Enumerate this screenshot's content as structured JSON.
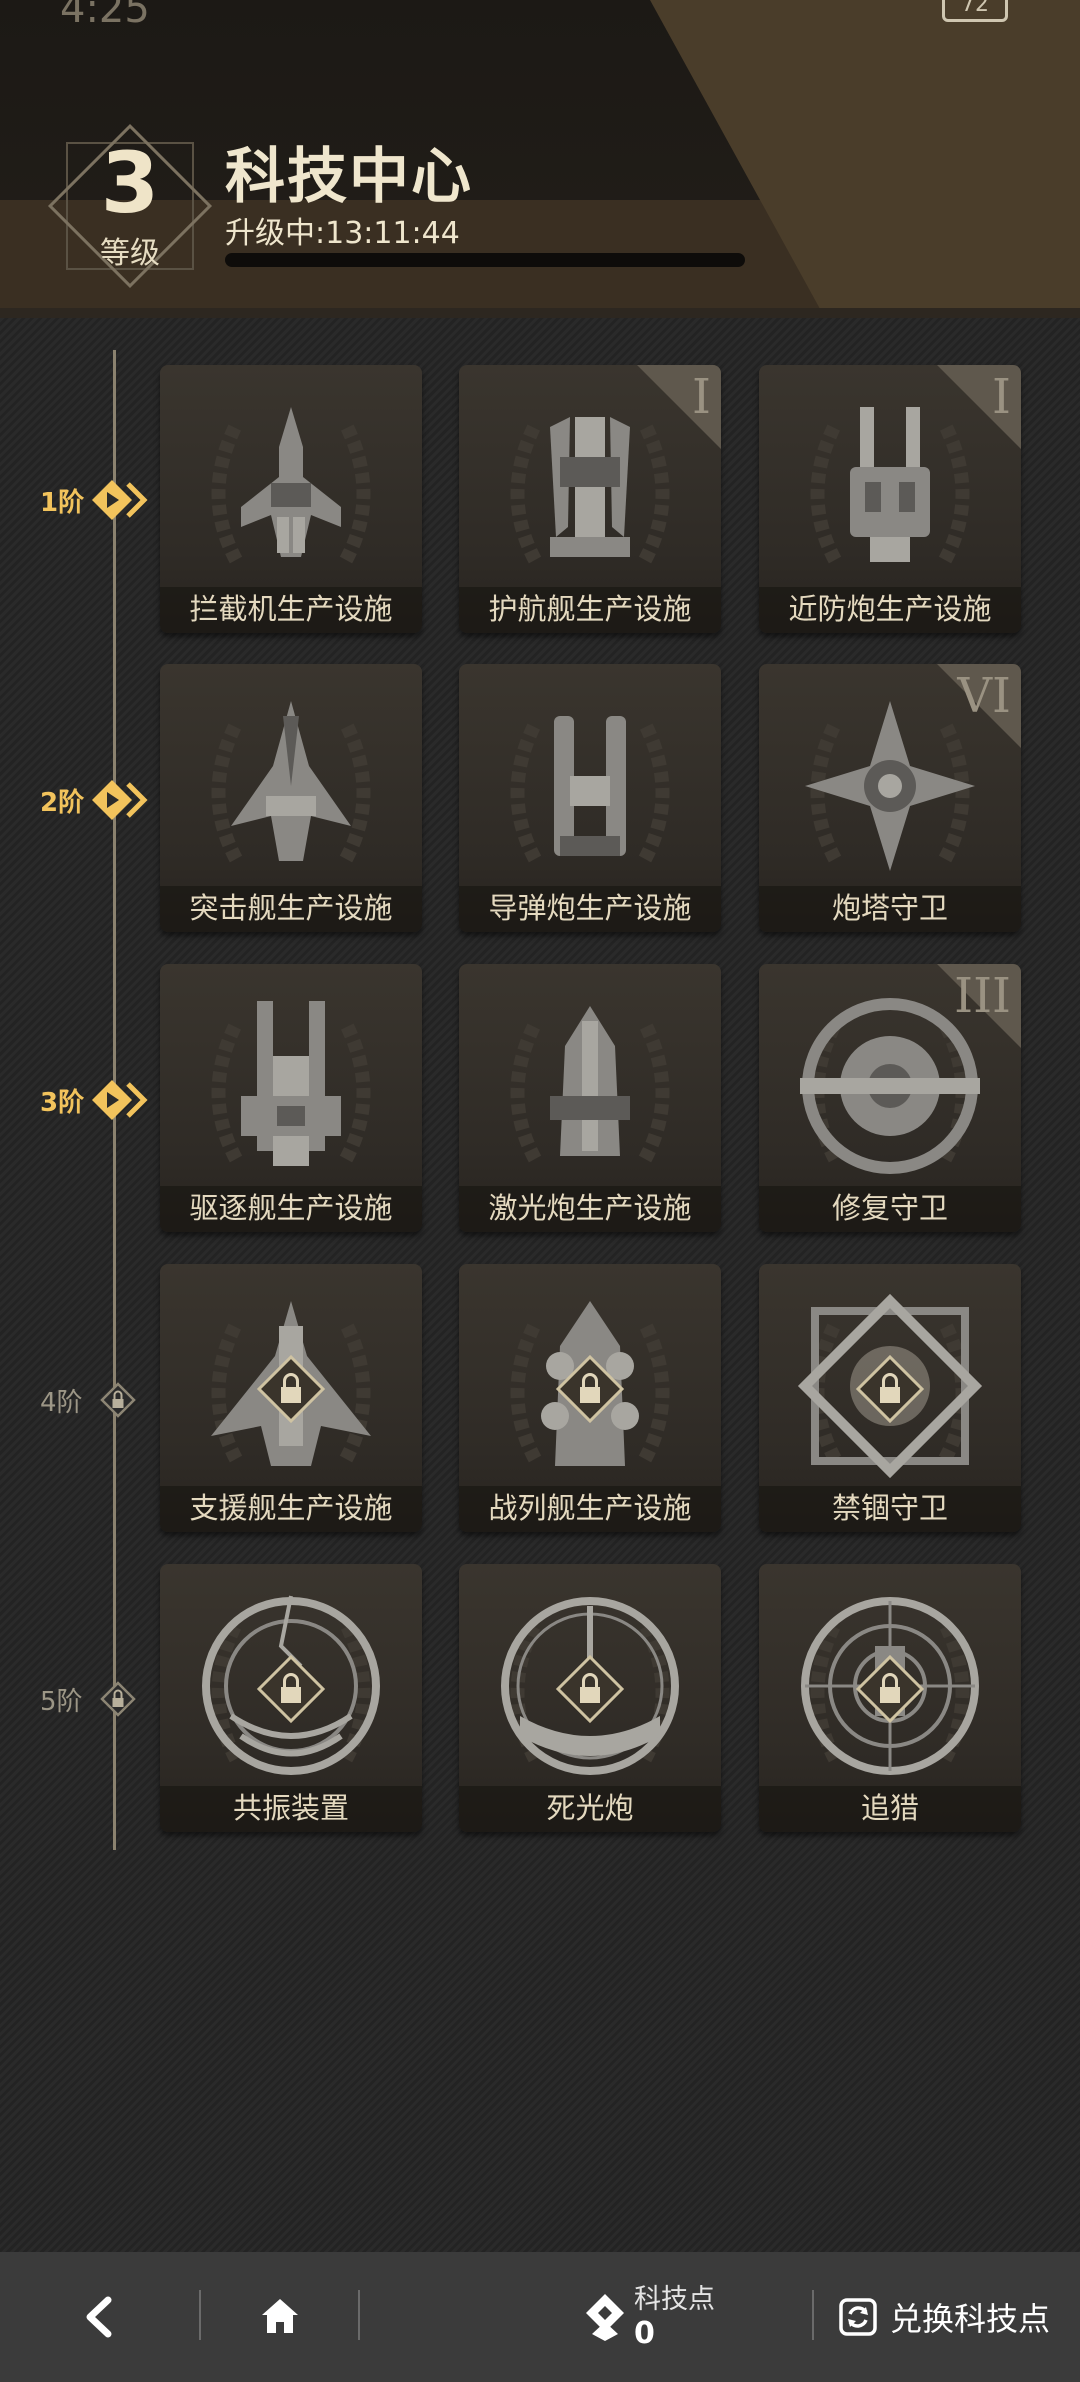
{
  "status": {
    "time": "4:25",
    "battery": "72"
  },
  "header": {
    "level_value": "3",
    "level_label": "等级",
    "title": "科技中心",
    "upgrade_status": "升级中:13:11:44",
    "upgrade_progress": 0.0
  },
  "tiers": [
    {
      "label": "1阶",
      "state": "active"
    },
    {
      "label": "2阶",
      "state": "active"
    },
    {
      "label": "3阶",
      "state": "active"
    },
    {
      "label": "4阶",
      "state": "locked"
    },
    {
      "label": "5阶",
      "state": "locked"
    }
  ],
  "cards": [
    {
      "name": "拦截机生产设施",
      "roman": "",
      "locked": false,
      "icon": "interceptor-ship-icon"
    },
    {
      "name": "护航舰生产设施",
      "roman": "I",
      "locked": false,
      "icon": "escort-ship-icon"
    },
    {
      "name": "近防炮生产设施",
      "roman": "I",
      "locked": false,
      "icon": "ciws-ship-icon"
    },
    {
      "name": "突击舰生产设施",
      "roman": "",
      "locked": false,
      "icon": "assault-ship-icon"
    },
    {
      "name": "导弹炮生产设施",
      "roman": "",
      "locked": false,
      "icon": "missile-ship-icon"
    },
    {
      "name": "炮塔守卫",
      "roman": "VI",
      "locked": false,
      "icon": "turret-guard-icon"
    },
    {
      "name": "驱逐舰生产设施",
      "roman": "",
      "locked": false,
      "icon": "destroyer-ship-icon"
    },
    {
      "name": "激光炮生产设施",
      "roman": "",
      "locked": false,
      "icon": "laser-ship-icon"
    },
    {
      "name": "修复守卫",
      "roman": "III",
      "locked": false,
      "icon": "repair-guard-icon"
    },
    {
      "name": "支援舰生产设施",
      "roman": "",
      "locked": true,
      "icon": "support-ship-icon"
    },
    {
      "name": "战列舰生产设施",
      "roman": "",
      "locked": true,
      "icon": "battleship-icon"
    },
    {
      "name": "禁锢守卫",
      "roman": "",
      "locked": true,
      "icon": "prison-guard-icon"
    },
    {
      "name": "共振装置",
      "roman": "",
      "locked": true,
      "icon": "resonance-device-icon"
    },
    {
      "name": "死光炮",
      "roman": "",
      "locked": true,
      "icon": "death-ray-icon"
    },
    {
      "name": "追猎",
      "roman": "",
      "locked": true,
      "icon": "hunt-icon"
    }
  ],
  "bottom_bar": {
    "tech_points_label": "科技点",
    "tech_points_value": "0",
    "exchange_label": "兑换科技点"
  },
  "colors": {
    "accent": "#f2c35c",
    "text": "#e4d9bf",
    "card": "#34302a"
  }
}
